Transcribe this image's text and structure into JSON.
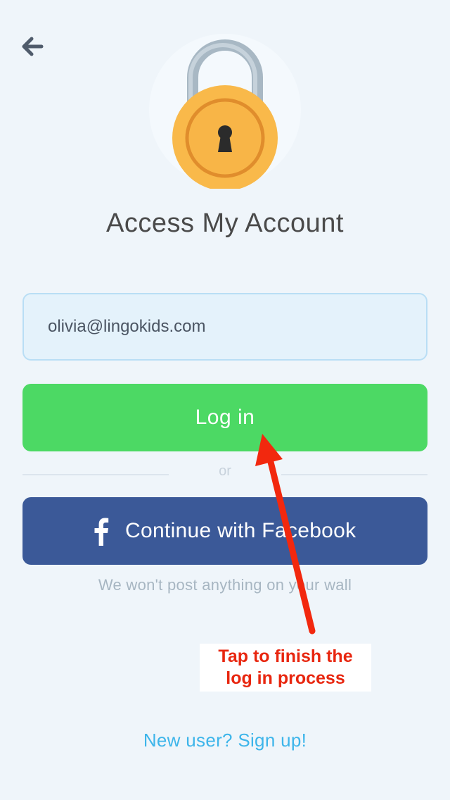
{
  "header": {
    "back_icon": "arrow-left-icon",
    "title": "Access My Account"
  },
  "hero": {
    "icon": "padlock-icon"
  },
  "form": {
    "email_value": "olivia@lingokids.com",
    "login_label": "Log in",
    "divider_label": "or",
    "facebook_icon": "facebook-f-icon",
    "facebook_label": "Continue with Facebook",
    "facebook_note": "We won't post anything on your wall"
  },
  "annotation": {
    "line1": "Tap to finish the",
    "line2": "log in process",
    "arrow_icon": "red-arrow-icon",
    "color": "#e8260f"
  },
  "footer": {
    "signup_label": "New user? Sign up!"
  },
  "colors": {
    "background": "#eff5fa",
    "login_green": "#4cd964",
    "facebook_blue": "#3b5998",
    "link_blue": "#3db5ea",
    "lock_gold": "#f9b94a"
  }
}
